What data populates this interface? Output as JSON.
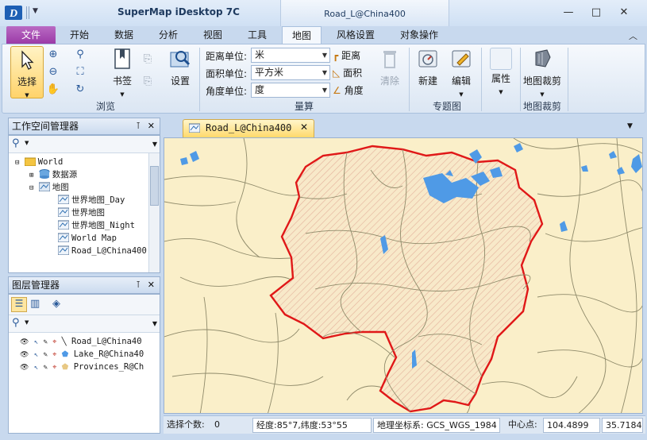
{
  "app": {
    "title": "SuperMap iDesktop 7C",
    "context_tab_title": "Road_L@China400"
  },
  "window_controls": {
    "minimize": "—",
    "maximize": "□",
    "close": "✕"
  },
  "ribbon_tabs": [
    {
      "label": "文件"
    },
    {
      "label": "开始"
    },
    {
      "label": "数据"
    },
    {
      "label": "分析"
    },
    {
      "label": "视图"
    },
    {
      "label": "工具"
    },
    {
      "label": "地图"
    },
    {
      "label": "风格设置"
    },
    {
      "label": "对象操作"
    }
  ],
  "ribbon": {
    "browse": {
      "select_label": "选择",
      "bookmark_label": "书签",
      "settings_label": "设置",
      "group_label": "浏览"
    },
    "measure": {
      "distance_unit_label": "距离单位:",
      "distance_unit_value": "米",
      "area_unit_label": "面积单位:",
      "area_unit_value": "平方米",
      "angle_unit_label": "角度单位:",
      "angle_unit_value": "度",
      "distance_btn": "距离",
      "area_btn": "面积",
      "angle_btn": "角度",
      "clear_btn": "清除",
      "group_label": "量算"
    },
    "thematic": {
      "new_label": "新建",
      "edit_label": "编辑",
      "group_label": "专题图"
    },
    "properties_label": "属性",
    "clip": {
      "clip_label": "地图裁剪",
      "group_label": "地图裁剪"
    }
  },
  "workspace_panel": {
    "title": "工作空间管理器",
    "tree": [
      {
        "label": "World"
      },
      {
        "label": "数据源"
      },
      {
        "label": "地图"
      },
      {
        "label": "世界地图_Day"
      },
      {
        "label": "世界地图"
      },
      {
        "label": "世界地图_Night"
      },
      {
        "label": "World Map"
      },
      {
        "label": "Road_L@China400"
      }
    ]
  },
  "layer_panel": {
    "title": "图层管理器",
    "layers": [
      {
        "label": "Road_L@China40"
      },
      {
        "label": "Lake_R@China40"
      },
      {
        "label": "Provinces_R@Ch"
      }
    ]
  },
  "document": {
    "tab_label": "Road_L@China400"
  },
  "statusbar": {
    "selected_count_label": "选择个数:",
    "selected_count": "0",
    "coords": "经度:85°7,纬度:53°55",
    "crs": "地理坐标系: GCS_WGS_1984",
    "center_label": "中心点:",
    "center_x": "104.4899",
    "center_y": "35.7184"
  },
  "colors": {
    "land": "#faefc9",
    "province_outline": "#e01818",
    "lake": "#4f9ae6",
    "road": "#8f8a6a",
    "selected_hatch": "#e8b3a0",
    "file_tab": "#9b3aa7"
  }
}
